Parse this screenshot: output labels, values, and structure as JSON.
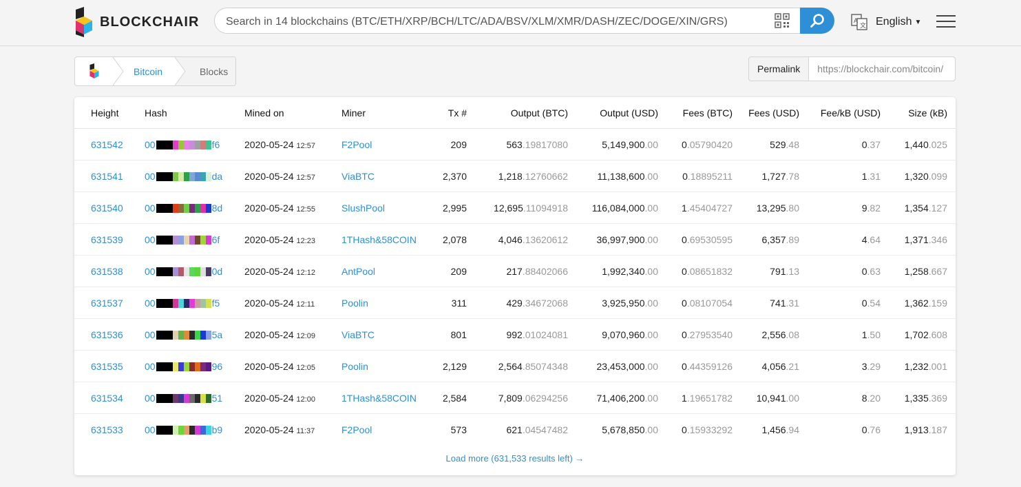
{
  "header": {
    "brand": "BLOCKCHAIR",
    "search_placeholder": "Search in 14 blockchains (BTC/ETH/XRP/BCH/LTC/ADA/BSV/XLM/XMR/DASH/ZEC/DOGE/XIN/GRS)",
    "language": "English"
  },
  "breadcrumb": {
    "bitcoin": "Bitcoin",
    "blocks": "Blocks"
  },
  "permalink": {
    "label": "Permalink",
    "url": "https://blockchair.com/bitcoin/"
  },
  "colors": {
    "accent": "#2e8fd6"
  },
  "table": {
    "columns": [
      "Height",
      "Hash",
      "Mined on",
      "Miner",
      "Tx #",
      "Output (BTC)",
      "Output (USD)",
      "Fees (BTC)",
      "Fees (USD)",
      "Fee/kB (USD)",
      "Size (kB)"
    ],
    "rows": [
      {
        "height": "631542",
        "hash_pre": "00",
        "hash_suf": "f6",
        "hash_colors": [
          "#000",
          "#000",
          "#000",
          "#e03ec6",
          "#9ac43a",
          "#e87fe6",
          "#c48fd6",
          "#a0a0a0",
          "#d47b7b",
          "#37c78f"
        ],
        "date": "2020-05-24",
        "time": "12:57",
        "miner": "F2Pool",
        "tx": "209",
        "out_btc_i": "563",
        "out_btc_f": ".19817080",
        "out_usd_i": "5,149,900",
        "out_usd_f": ".00",
        "fee_btc_i": "0",
        "fee_btc_f": ".05790420",
        "fee_usd_i": "529",
        "fee_usd_f": ".48",
        "feekb_i": "0",
        "feekb_f": ".37",
        "size_i": "1,440",
        "size_f": ".025"
      },
      {
        "height": "631541",
        "hash_pre": "00",
        "hash_suf": "da",
        "hash_colors": [
          "#000",
          "#000",
          "#000",
          "#7fc44b",
          "#d4eaa9",
          "#2ba14b",
          "#7ea8d3",
          "#5a8ad6",
          "#3aa5b0",
          "#d9f0d9"
        ],
        "date": "2020-05-24",
        "time": "12:57",
        "miner": "ViaBTC",
        "tx": "2,370",
        "out_btc_i": "1,218",
        "out_btc_f": ".12760662",
        "out_usd_i": "11,138,600",
        "out_usd_f": ".00",
        "fee_btc_i": "0",
        "fee_btc_f": ".18895211",
        "fee_usd_i": "1,727",
        "fee_usd_f": ".78",
        "feekb_i": "1",
        "feekb_f": ".31",
        "size_i": "1,320",
        "size_f": ".099"
      },
      {
        "height": "631540",
        "hash_pre": "00",
        "hash_suf": "8d",
        "hash_colors": [
          "#000",
          "#000",
          "#000",
          "#e23b1a",
          "#8b6b3a",
          "#6ad04a",
          "#7b2a7b",
          "#2ba14b",
          "#e030a8",
          "#1a3ad6"
        ],
        "date": "2020-05-24",
        "time": "12:55",
        "miner": "SlushPool",
        "tx": "2,995",
        "out_btc_i": "12,695",
        "out_btc_f": ".11094918",
        "out_usd_i": "116,084,000",
        "out_usd_f": ".00",
        "fee_btc_i": "1",
        "fee_btc_f": ".45404727",
        "fee_usd_i": "13,295",
        "fee_usd_f": ".80",
        "feekb_i": "9",
        "feekb_f": ".82",
        "size_i": "1,354",
        "size_f": ".127"
      },
      {
        "height": "631539",
        "hash_pre": "00",
        "hash_suf": "6f",
        "hash_colors": [
          "#000",
          "#000",
          "#000",
          "#b58fd6",
          "#8aa0e0",
          "#e6d6b0",
          "#c46ad6",
          "#6a4a2a",
          "#9fd43a",
          "#d63ad6"
        ],
        "date": "2020-05-24",
        "time": "12:23",
        "miner": "1THash&58COIN",
        "tx": "2,078",
        "out_btc_i": "4,046",
        "out_btc_f": ".13620612",
        "out_usd_i": "36,997,900",
        "out_usd_f": ".00",
        "fee_btc_i": "0",
        "fee_btc_f": ".69530595",
        "fee_usd_i": "6,357",
        "fee_usd_f": ".89",
        "feekb_i": "4",
        "feekb_f": ".64",
        "size_i": "1,371",
        "size_f": ".346"
      },
      {
        "height": "631538",
        "hash_pre": "00",
        "hash_suf": "0d",
        "hash_colors": [
          "#000",
          "#000",
          "#000",
          "#a78fd6",
          "#b05a6a",
          "#e6e6e6",
          "#5ad65a",
          "#5ad63a",
          "#e0e0e0",
          "#4a3a6a"
        ],
        "date": "2020-05-24",
        "time": "12:12",
        "miner": "AntPool",
        "tx": "209",
        "out_btc_i": "217",
        "out_btc_f": ".88402066",
        "out_usd_i": "1,992,340",
        "out_usd_f": ".00",
        "fee_btc_i": "0",
        "fee_btc_f": ".08651832",
        "fee_usd_i": "791",
        "fee_usd_f": ".13",
        "feekb_i": "0",
        "feekb_f": ".63",
        "size_i": "1,258",
        "size_f": ".667"
      },
      {
        "height": "631537",
        "hash_pre": "00",
        "hash_suf": "f5",
        "hash_colors": [
          "#000",
          "#000",
          "#000",
          "#d6349a",
          "#4ad6d6",
          "#2a2a6a",
          "#e63ad6",
          "#c4a0a0",
          "#a0c4a0",
          "#d6e04a"
        ],
        "date": "2020-05-24",
        "time": "12:11",
        "miner": "Poolin",
        "tx": "311",
        "out_btc_i": "429",
        "out_btc_f": ".34672068",
        "out_usd_i": "3,925,950",
        "out_usd_f": ".00",
        "fee_btc_i": "0",
        "fee_btc_f": ".08107054",
        "fee_usd_i": "741",
        "fee_usd_f": ".31",
        "feekb_i": "0",
        "feekb_f": ".54",
        "size_i": "1,362",
        "size_f": ".159"
      },
      {
        "height": "631536",
        "hash_pre": "00",
        "hash_suf": "5a",
        "hash_colors": [
          "#000",
          "#000",
          "#000",
          "#e0d0b0",
          "#6ab04a",
          "#e08a3a",
          "#2a2a2a",
          "#3ad64a",
          "#1a3ad6",
          "#8aa0e6"
        ],
        "date": "2020-05-24",
        "time": "12:09",
        "miner": "ViaBTC",
        "tx": "801",
        "out_btc_i": "992",
        "out_btc_f": ".01024081",
        "out_usd_i": "9,070,960",
        "out_usd_f": ".00",
        "fee_btc_i": "0",
        "fee_btc_f": ".27953540",
        "fee_usd_i": "2,556",
        "fee_usd_f": ".08",
        "feekb_i": "1",
        "feekb_f": ".50",
        "size_i": "1,702",
        "size_f": ".608"
      },
      {
        "height": "631535",
        "hash_pre": "00",
        "hash_suf": "96",
        "hash_colors": [
          "#000",
          "#000",
          "#000",
          "#e6e66a",
          "#3a3ad6",
          "#9ad63a",
          "#8a2a2a",
          "#e06a1a",
          "#7a2a7a",
          "#5a1a8a"
        ],
        "date": "2020-05-24",
        "time": "12:05",
        "miner": "Poolin",
        "tx": "2,129",
        "out_btc_i": "2,564",
        "out_btc_f": ".85074348",
        "out_usd_i": "23,453,000",
        "out_usd_f": ".00",
        "fee_btc_i": "0",
        "fee_btc_f": ".44359126",
        "fee_usd_i": "4,056",
        "fee_usd_f": ".21",
        "feekb_i": "3",
        "feekb_f": ".29",
        "size_i": "1,232",
        "size_f": ".001"
      },
      {
        "height": "631534",
        "hash_pre": "00",
        "hash_suf": "51",
        "hash_colors": [
          "#000",
          "#000",
          "#000",
          "#6a3a6a",
          "#3a3a8a",
          "#d63ad6",
          "#6a6a6a",
          "#2a2a2a",
          "#d6e04a",
          "#2a6a2a"
        ],
        "date": "2020-05-24",
        "time": "12:00",
        "miner": "1THash&58COIN",
        "tx": "2,584",
        "out_btc_i": "7,809",
        "out_btc_f": ".06294256",
        "out_usd_i": "71,406,200",
        "out_usd_f": ".00",
        "fee_btc_i": "1",
        "fee_btc_f": ".19651782",
        "fee_usd_i": "10,941",
        "fee_usd_f": ".00",
        "feekb_i": "8",
        "feekb_f": ".20",
        "size_i": "1,335",
        "size_f": ".369"
      },
      {
        "height": "631533",
        "hash_pre": "00",
        "hash_suf": "b9",
        "hash_colors": [
          "#000",
          "#000",
          "#000",
          "#d0f0b0",
          "#6ad63a",
          "#e0a06a",
          "#2a2a2a",
          "#d63ad6",
          "#3a6ad6",
          "#3ad6e0"
        ],
        "date": "2020-05-24",
        "time": "11:37",
        "miner": "F2Pool",
        "tx": "573",
        "out_btc_i": "621",
        "out_btc_f": ".04547482",
        "out_usd_i": "5,678,850",
        "out_usd_f": ".00",
        "fee_btc_i": "0",
        "fee_btc_f": ".15933292",
        "fee_usd_i": "1,456",
        "fee_usd_f": ".94",
        "feekb_i": "0",
        "feekb_f": ".76",
        "size_i": "1,913",
        "size_f": ".187"
      }
    ],
    "load_more": "Load more (631,533 results left) →"
  }
}
